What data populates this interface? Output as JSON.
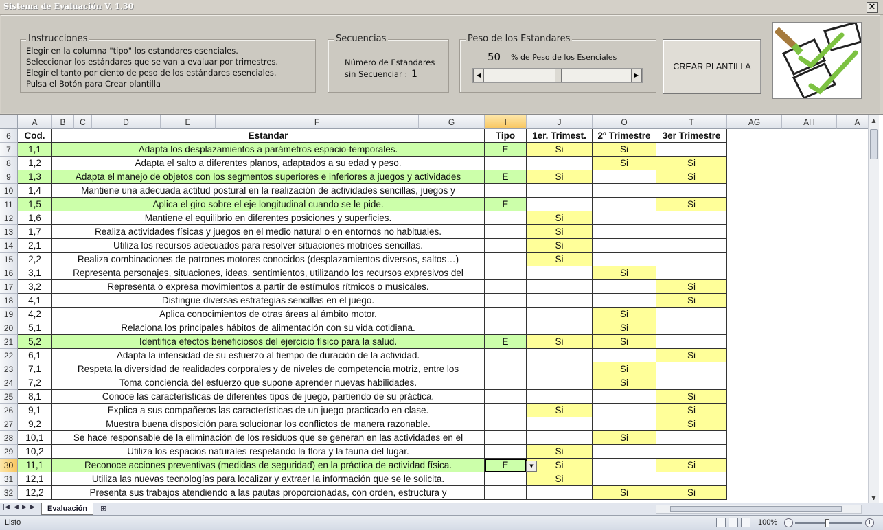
{
  "window": {
    "title": "Sistema de Evaluación   V. 1.30",
    "close_glyph": "✕"
  },
  "instrucciones": {
    "legend": "Instrucciones",
    "lines": [
      "Elegir en la columna \"tipo\" los estandares esenciales.",
      "Seleccionar los estándares que se van a evaluar por trimestres.",
      "Elegir el tanto por ciento de peso de los estándares esenciales.",
      "Pulsa el Botón para Crear plantilla"
    ]
  },
  "secuencias": {
    "legend": "Secuencias",
    "line1": "Número de Estandares",
    "line2": "sin Secuenciar  :",
    "count": "1"
  },
  "peso": {
    "legend": "Peso de los Estandares",
    "value": "50",
    "label": "% de Peso de los Esenciales",
    "slider_level": 0.5
  },
  "crear_button": "CREAR PLANTILLA",
  "sheet": {
    "col_letters": [
      "A",
      "B",
      "C",
      "D",
      "E",
      "F",
      "G",
      "I",
      "J",
      "O",
      "T",
      "AG",
      "AH",
      "A"
    ],
    "headers": {
      "row": "6",
      "cod": "Cod.",
      "estandar": "Estandar",
      "tipo": "Tipo",
      "t1": "1er. Trimest.",
      "t2": "2º Trimestre",
      "t3": "3er Trimestre"
    },
    "active_row": "30",
    "rows": [
      {
        "r": "7",
        "cod": "1,1",
        "text": "Adapta los desplazamientos a parámetros espacio-temporales.",
        "tipo": "E",
        "t1": "Si",
        "t2": "Si",
        "t3": ""
      },
      {
        "r": "8",
        "cod": "1,2",
        "text": "Adapta el salto a diferentes planos, adaptados a su edad y peso.",
        "tipo": "",
        "t1": "",
        "t2": "Si",
        "t3": "Si"
      },
      {
        "r": "9",
        "cod": "1,3",
        "text": "Adapta el manejo de objetos con los segmentos superiores e inferiores a juegos y actividades",
        "tipo": "E",
        "t1": "Si",
        "t2": "",
        "t3": "Si"
      },
      {
        "r": "10",
        "cod": "1,4",
        "text": "Mantiene una adecuada actitud postural en la realización de actividades sencillas, juegos y",
        "tipo": "",
        "t1": "",
        "t2": "",
        "t3": ""
      },
      {
        "r": "11",
        "cod": "1,5",
        "text": "Aplica el giro sobre el eje longitudinal cuando se le pide.",
        "tipo": "E",
        "t1": "",
        "t2": "",
        "t3": "Si"
      },
      {
        "r": "12",
        "cod": "1,6",
        "text": "Mantiene el equilibrio en diferentes posiciones y superficies.",
        "tipo": "",
        "t1": "Si",
        "t2": "",
        "t3": ""
      },
      {
        "r": "13",
        "cod": "1,7",
        "text": "Realiza actividades físicas y juegos en el medio natural o en entornos no habituales.",
        "tipo": "",
        "t1": "Si",
        "t2": "",
        "t3": ""
      },
      {
        "r": "14",
        "cod": "2,1",
        "text": "Utiliza los recursos adecuados para resolver situaciones motrices sencillas.",
        "tipo": "",
        "t1": "Si",
        "t2": "",
        "t3": ""
      },
      {
        "r": "15",
        "cod": "2,2",
        "text": "Realiza combinaciones de patrones motores conocidos (desplazamientos diversos, saltos…)",
        "tipo": "",
        "t1": "Si",
        "t2": "",
        "t3": ""
      },
      {
        "r": "16",
        "cod": "3,1",
        "text": "Representa personajes, situaciones, ideas, sentimientos, utilizando los recursos expresivos del",
        "tipo": "",
        "t1": "",
        "t2": "Si",
        "t3": ""
      },
      {
        "r": "17",
        "cod": "3,2",
        "text": "Representa o expresa movimientos a partir de estímulos rítmicos o musicales.",
        "tipo": "",
        "t1": "",
        "t2": "",
        "t3": "Si"
      },
      {
        "r": "18",
        "cod": "4,1",
        "text": "Distingue diversas estrategias sencillas en el juego.",
        "tipo": "",
        "t1": "",
        "t2": "",
        "t3": "Si"
      },
      {
        "r": "19",
        "cod": "4,2",
        "text": "Aplica conocimientos de otras áreas al ámbito motor.",
        "tipo": "",
        "t1": "",
        "t2": "Si",
        "t3": ""
      },
      {
        "r": "20",
        "cod": "5,1",
        "text": "Relaciona los principales hábitos de alimentación con su vida cotidiana.",
        "tipo": "",
        "t1": "",
        "t2": "Si",
        "t3": ""
      },
      {
        "r": "21",
        "cod": "5,2",
        "text": "Identifica efectos beneficiosos del ejercicio físico para la salud.",
        "tipo": "E",
        "t1": "Si",
        "t2": "Si",
        "t3": ""
      },
      {
        "r": "22",
        "cod": "6,1",
        "text": "Adapta la intensidad de su esfuerzo al tiempo de duración de la actividad.",
        "tipo": "",
        "t1": "",
        "t2": "",
        "t3": "Si"
      },
      {
        "r": "23",
        "cod": "7,1",
        "text": "Respeta la diversidad de realidades corporales y de niveles de competencia motriz, entre los",
        "tipo": "",
        "t1": "",
        "t2": "Si",
        "t3": ""
      },
      {
        "r": "24",
        "cod": "7,2",
        "text": "Toma conciencia del esfuerzo que supone aprender nuevas habilidades.",
        "tipo": "",
        "t1": "",
        "t2": "Si",
        "t3": ""
      },
      {
        "r": "25",
        "cod": "8,1",
        "text": "Conoce las características de diferentes tipos de juego, partiendo de su práctica.",
        "tipo": "",
        "t1": "",
        "t2": "",
        "t3": "Si"
      },
      {
        "r": "26",
        "cod": "9,1",
        "text": "Explica a sus compañeros las características de un juego practicado en clase.",
        "tipo": "",
        "t1": "Si",
        "t2": "",
        "t3": "Si"
      },
      {
        "r": "27",
        "cod": "9,2",
        "text": "Muestra buena disposición para solucionar los conflictos de manera razonable.",
        "tipo": "",
        "t1": "",
        "t2": "",
        "t3": "Si"
      },
      {
        "r": "28",
        "cod": "10,1",
        "text": "Se hace responsable de la eliminación de los residuos que se generan en las actividades en el",
        "tipo": "",
        "t1": "",
        "t2": "Si",
        "t3": ""
      },
      {
        "r": "29",
        "cod": "10,2",
        "text": "Utiliza los espacios naturales respetando la flora y la fauna del lugar.",
        "tipo": "",
        "t1": "Si",
        "t2": "",
        "t3": ""
      },
      {
        "r": "30",
        "cod": "11,1",
        "text": "Reconoce acciones preventivas (medidas de seguridad) en la práctica de actividad física.",
        "tipo": "E",
        "t1": "Si",
        "t2": "",
        "t3": "Si"
      },
      {
        "r": "31",
        "cod": "12,1",
        "text": "Utiliza las nuevas tecnologías para localizar y extraer la información que se le solicita.",
        "tipo": "",
        "t1": "Si",
        "t2": "",
        "t3": ""
      },
      {
        "r": "32",
        "cod": "12,2",
        "text": "Presenta sus trabajos atendiendo a las pautas proporcionadas, con orden, estructura y",
        "tipo": "",
        "t1": "",
        "t2": "Si",
        "t3": "Si"
      }
    ]
  },
  "sheet_tab": "Evaluación",
  "status": {
    "ready": "Listo",
    "zoom": "100%"
  },
  "colors": {
    "green": "#ccffaa",
    "yellow": "#ffff99"
  }
}
